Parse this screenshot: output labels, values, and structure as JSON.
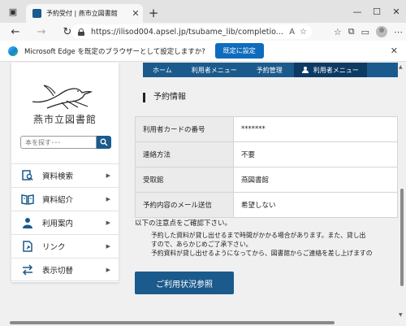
{
  "browser": {
    "tab_title": "予約受付 | 燕市立図書館",
    "url": "https://ilisod004.apsel.jp/tsubame_lib/completio..."
  },
  "infobar": {
    "message": "Microsoft Edge を既定のブラウザーとして設定しますか?",
    "button_label": "既定に設定"
  },
  "sidebar": {
    "library_name": "燕市立図書館",
    "search_placeholder": "本を探す･･･",
    "items": [
      {
        "label": "資料検索",
        "icon": "search-doc-icon"
      },
      {
        "label": "資料紹介",
        "icon": "book-open-icon"
      },
      {
        "label": "利用案内",
        "icon": "person-icon"
      },
      {
        "label": "リンク",
        "icon": "link-doc-icon"
      },
      {
        "label": "表示切替",
        "icon": "switch-arrows-icon"
      }
    ]
  },
  "topnav": {
    "items": [
      "ホーム",
      "利用者メニュー",
      "予約管理"
    ],
    "user_menu": "利用者メニュー"
  },
  "main": {
    "section_title": "予約情報",
    "rows": [
      {
        "label": "利用者カードの番号",
        "value": "*******"
      },
      {
        "label": "連絡方法",
        "value": "不要"
      },
      {
        "label": "受取館",
        "value": "燕図書館"
      },
      {
        "label": "予約内容のメール送信",
        "value": "希望しない"
      }
    ],
    "notice_heading": "以下の注意点をご確認下さい。",
    "notices": [
      "予約した資料が貸し出せるまで時間がかかる場合があります。また、貸し出",
      "すので、あらかじめご了承下さい。",
      "予約資料が貸し出せるようになってから、図書館からご連絡を差し上げますの"
    ],
    "button_label": "ご利用状況参照"
  },
  "colors": {
    "brand": "#1b5a8c",
    "brand_dark": "#0d3a63",
    "edge_blue": "#0f6cbd"
  }
}
